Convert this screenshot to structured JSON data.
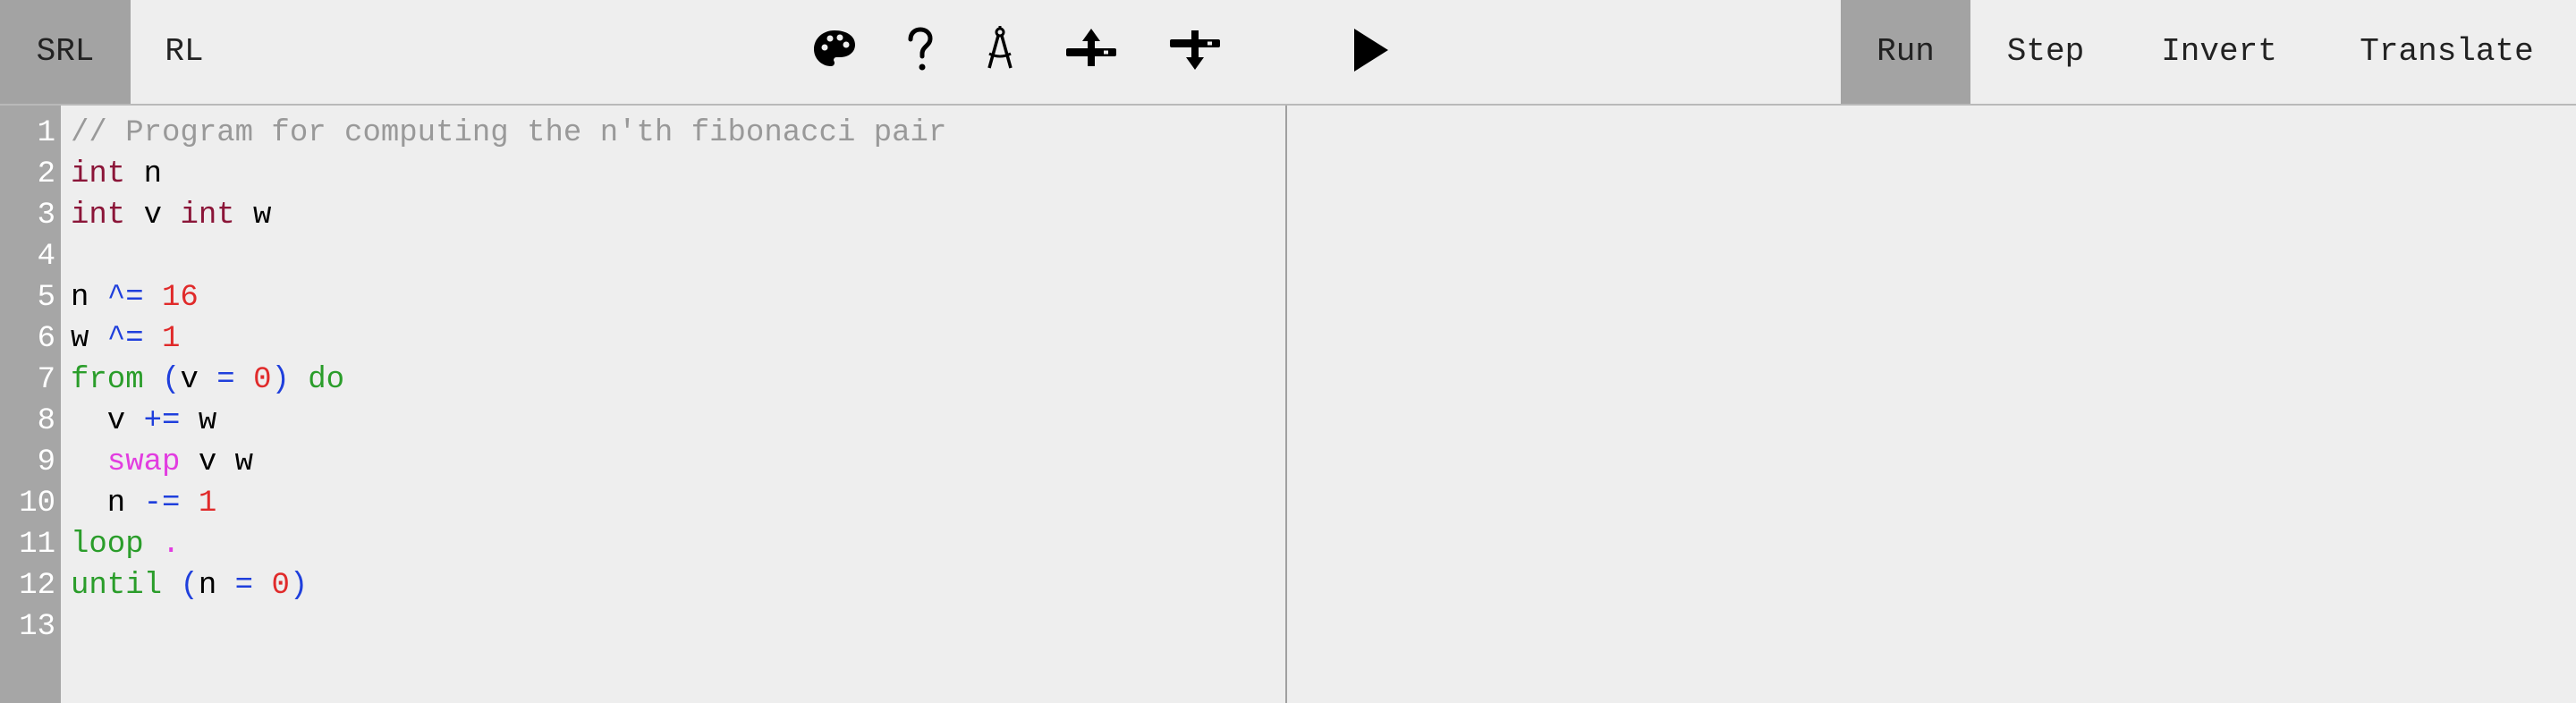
{
  "tabs": {
    "srl": "SRL",
    "rl": "RL"
  },
  "toolbar": {
    "icons": [
      "palette-icon",
      "help-icon",
      "compass-icon",
      "step-up-icon",
      "step-down-icon",
      "play-icon"
    ]
  },
  "actions": {
    "run": "Run",
    "step": "Step",
    "invert": "Invert",
    "translate": "Translate"
  },
  "colors": {
    "type": "#8b1538",
    "operator": "#1f3fdc",
    "number": "#e02a2a",
    "keyword": "#2a9d2a",
    "swap": "#e23de0",
    "comment": "#999999",
    "text": "#000000",
    "gutter": "#a6a6a6",
    "active_tab": "#a3a3a3"
  },
  "editor": {
    "line_numbers": [
      "1",
      "2",
      "3",
      "4",
      "5",
      "6",
      "7",
      "8",
      "9",
      "10",
      "11",
      "12",
      "13"
    ],
    "lines": [
      [
        {
          "t": "// Program for computing the n'th fibonacci pair",
          "c": "comment"
        }
      ],
      [
        {
          "t": "int",
          "c": "type"
        },
        {
          "t": " n",
          "c": "text"
        }
      ],
      [
        {
          "t": "int",
          "c": "type"
        },
        {
          "t": " v ",
          "c": "text"
        },
        {
          "t": "int",
          "c": "type"
        },
        {
          "t": " w",
          "c": "text"
        }
      ],
      [],
      [
        {
          "t": "n ",
          "c": "text"
        },
        {
          "t": "^=",
          "c": "operator"
        },
        {
          "t": " ",
          "c": "text"
        },
        {
          "t": "16",
          "c": "number"
        }
      ],
      [
        {
          "t": "w ",
          "c": "text"
        },
        {
          "t": "^=",
          "c": "operator"
        },
        {
          "t": " ",
          "c": "text"
        },
        {
          "t": "1",
          "c": "number"
        }
      ],
      [
        {
          "t": "from",
          "c": "keyword"
        },
        {
          "t": " ",
          "c": "text"
        },
        {
          "t": "(",
          "c": "operator"
        },
        {
          "t": "v ",
          "c": "text"
        },
        {
          "t": "=",
          "c": "operator"
        },
        {
          "t": " ",
          "c": "text"
        },
        {
          "t": "0",
          "c": "number"
        },
        {
          "t": ")",
          "c": "operator"
        },
        {
          "t": " ",
          "c": "text"
        },
        {
          "t": "do",
          "c": "keyword"
        }
      ],
      [
        {
          "t": "  v ",
          "c": "text"
        },
        {
          "t": "+=",
          "c": "operator"
        },
        {
          "t": " w",
          "c": "text"
        }
      ],
      [
        {
          "t": "  ",
          "c": "text"
        },
        {
          "t": "swap",
          "c": "swap"
        },
        {
          "t": " v w",
          "c": "text"
        }
      ],
      [
        {
          "t": "  n ",
          "c": "text"
        },
        {
          "t": "-=",
          "c": "operator"
        },
        {
          "t": " ",
          "c": "text"
        },
        {
          "t": "1",
          "c": "number"
        }
      ],
      [
        {
          "t": "loop",
          "c": "keyword"
        },
        {
          "t": " ",
          "c": "text"
        },
        {
          "t": ".",
          "c": "swap"
        }
      ],
      [
        {
          "t": "until",
          "c": "keyword"
        },
        {
          "t": " ",
          "c": "text"
        },
        {
          "t": "(",
          "c": "operator"
        },
        {
          "t": "n ",
          "c": "text"
        },
        {
          "t": "=",
          "c": "operator"
        },
        {
          "t": " ",
          "c": "text"
        },
        {
          "t": "0",
          "c": "number"
        },
        {
          "t": ")",
          "c": "operator"
        }
      ],
      []
    ]
  },
  "output": {
    "text": ""
  }
}
